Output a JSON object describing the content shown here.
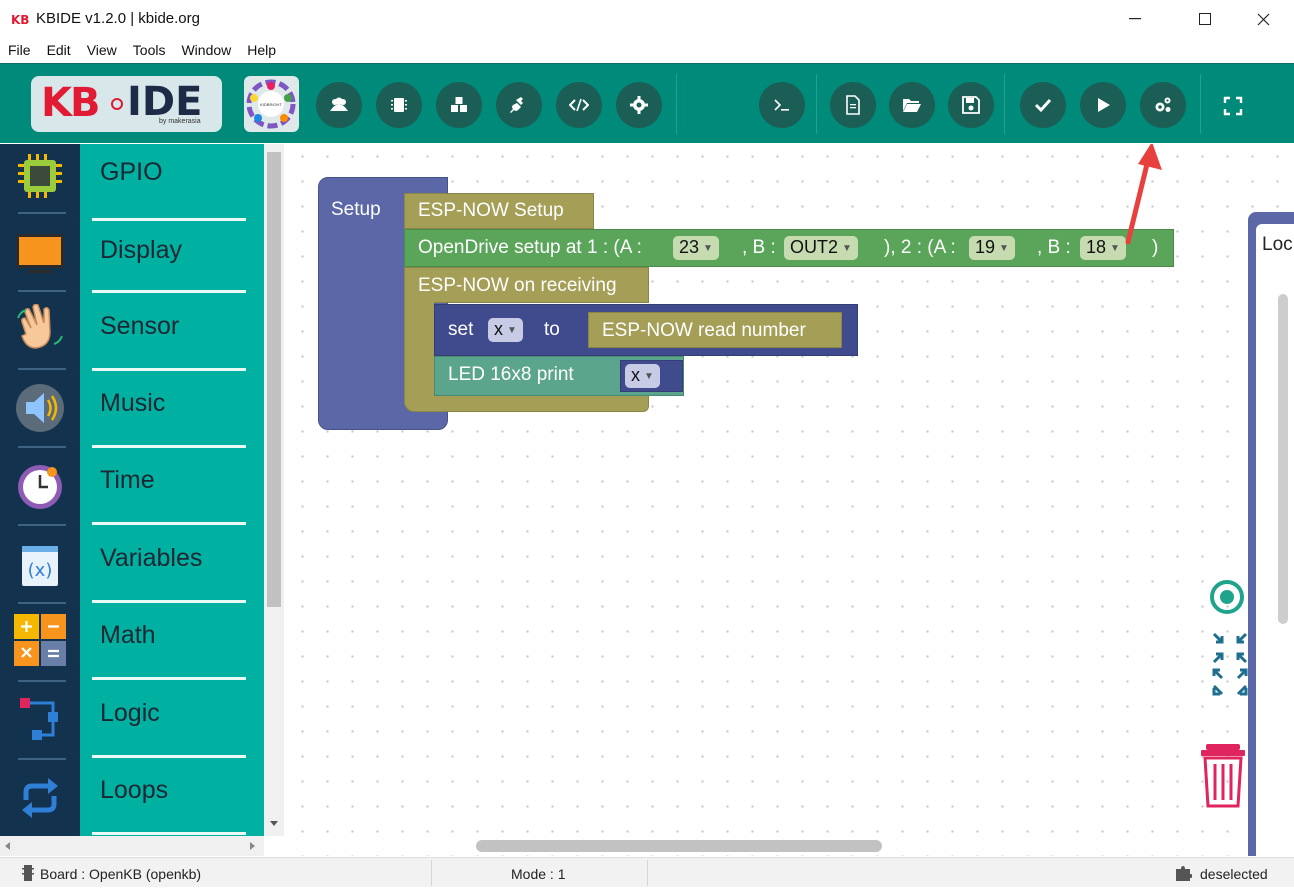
{
  "window": {
    "title": "KBIDE v1.2.0 | kbide.org",
    "app_icon_text": "KB",
    "controls": [
      "minimize",
      "maximize",
      "close"
    ]
  },
  "menu": [
    "File",
    "Edit",
    "View",
    "Tools",
    "Window",
    "Help"
  ],
  "toolbar": {
    "logo_text_kb": "KB",
    "logo_text_ide": "IDE",
    "logo_by": "by makerasia",
    "community_label": "KIDBRIGHT COMMUNITY",
    "buttons": [
      "users-icon",
      "board-icon",
      "plugins-icon",
      "plug-icon",
      "code-icon",
      "settings-icon",
      "terminal-icon",
      "new-file-icon",
      "open-folder-icon",
      "save-icon",
      "verify-icon",
      "run-icon",
      "cogs-icon",
      "fullscreen-icon"
    ]
  },
  "categories": [
    {
      "label": "GPIO",
      "icon": "chip-icon"
    },
    {
      "label": "Display",
      "icon": "display-icon"
    },
    {
      "label": "Sensor",
      "icon": "hand-icon"
    },
    {
      "label": "Music",
      "icon": "speaker-icon"
    },
    {
      "label": "Time",
      "icon": "clock-icon"
    },
    {
      "label": "Variables",
      "icon": "variable-icon"
    },
    {
      "label": "Math",
      "icon": "math-icon"
    },
    {
      "label": "Logic",
      "icon": "logic-icon"
    },
    {
      "label": "Loops",
      "icon": "loop-icon"
    }
  ],
  "blocks": {
    "setup_label": "Setup",
    "espnow_setup": "ESP-NOW Setup",
    "opendrive": {
      "prefix": "OpenDrive setup at 1 : (A :",
      "a1": "23",
      "sep1": ", B :",
      "b1": "OUT2",
      "mid": "), 2 : (A :",
      "a2": "19",
      "sep2": ", B :",
      "b2": "18",
      "suffix": ")"
    },
    "espnow_receive": "ESP-NOW on receiving",
    "set_label": "set",
    "set_var": "x",
    "to_label": "to",
    "read_number": "ESP-NOW read number",
    "led_print": "LED 16x8 print",
    "print_var": "x"
  },
  "flyout_label": "Loc",
  "status": {
    "board": "Board : OpenKB (openkb)",
    "mode": "Mode : 1",
    "selection": "deselected"
  },
  "colors": {
    "toolbar": "#008a7a",
    "sidebar": "#00b0a0",
    "setup_block": "#5b67a6",
    "espnow_block": "#a59e57",
    "opendrive_block": "#5ba55b",
    "led_block": "#5ba58c",
    "annotation_arrow": "#e8403d"
  }
}
